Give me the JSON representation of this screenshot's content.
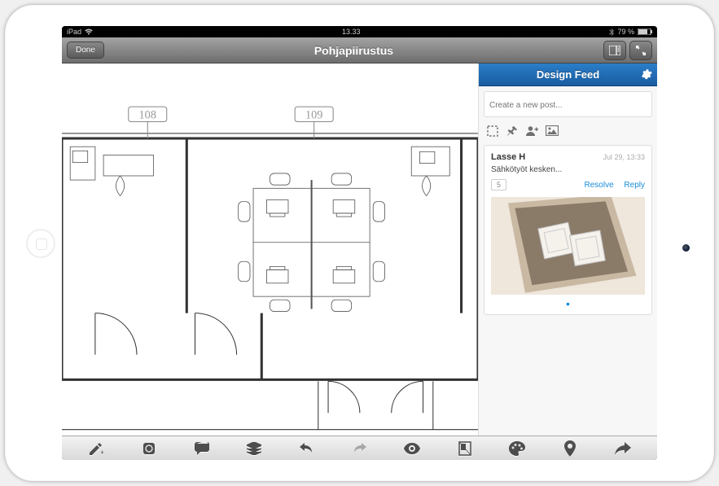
{
  "statusbar": {
    "carrier": "iPad",
    "time": "13.33",
    "battery": "79 %"
  },
  "navbar": {
    "done_label": "Done",
    "title": "Pohjapiirustus"
  },
  "floorplan": {
    "room_labels": [
      "108",
      "109"
    ]
  },
  "sidebar": {
    "title": "Design Feed",
    "compose_placeholder": "Create a new post...",
    "post": {
      "author": "Lasse H",
      "date": "Jul 29, 13:33",
      "body": "Sähkötyöt kesken...",
      "count": "5",
      "resolve_label": "Resolve",
      "reply_label": "Reply"
    }
  }
}
